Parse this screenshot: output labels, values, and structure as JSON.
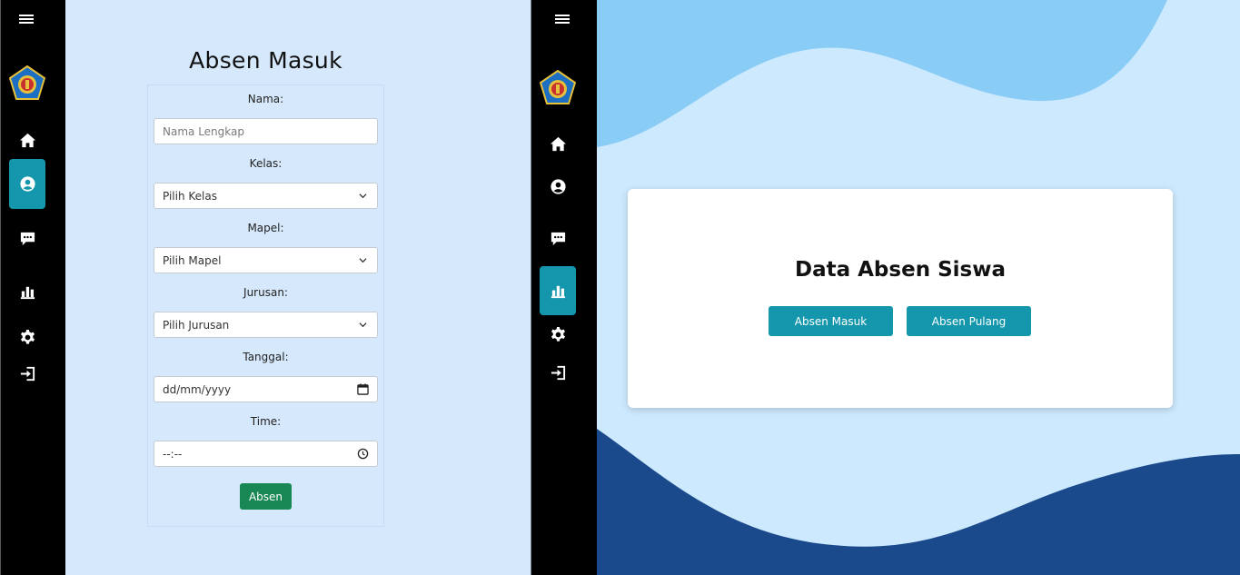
{
  "colors": {
    "sidebar_bg": "#000000",
    "active_nav": "#1497ad",
    "form_bg": "#d6e8fb",
    "submit_green": "#198754",
    "wave_light": "#89cdf6",
    "wave_dark": "#1a4a8c",
    "content_bg": "#cde9fd"
  },
  "left_pane": {
    "sidebar": {
      "items": [
        {
          "icon": "menu-icon"
        },
        {
          "icon": "school-logo"
        },
        {
          "icon": "home-icon"
        },
        {
          "icon": "user-icon",
          "active": true
        },
        {
          "icon": "comment-icon"
        },
        {
          "icon": "chart-icon"
        },
        {
          "icon": "gear-icon"
        },
        {
          "icon": "logout-icon"
        }
      ]
    },
    "form": {
      "title": "Absen Masuk",
      "nama_label": "Nama:",
      "nama_placeholder": "Nama Lengkap",
      "kelas_label": "Kelas:",
      "kelas_value": "Pilih Kelas",
      "mapel_label": "Mapel:",
      "mapel_value": "Pilih Mapel",
      "jurusan_label": "Jurusan:",
      "jurusan_value": "Pilih Jurusan",
      "tanggal_label": "Tanggal:",
      "tanggal_value": "dd/mm/yyyy",
      "time_label": "Time:",
      "time_value": "--:--",
      "submit_label": "Absen"
    }
  },
  "right_pane": {
    "sidebar": {
      "items": [
        {
          "icon": "menu-icon"
        },
        {
          "icon": "school-logo"
        },
        {
          "icon": "home-icon"
        },
        {
          "icon": "user-icon"
        },
        {
          "icon": "comment-icon"
        },
        {
          "icon": "chart-icon",
          "active": true
        },
        {
          "icon": "gear-icon"
        },
        {
          "icon": "logout-icon"
        }
      ]
    },
    "card": {
      "title": "Data Absen Siswa",
      "absen_masuk_label": "Absen Masuk",
      "absen_pulang_label": "Absen Pulang"
    }
  }
}
